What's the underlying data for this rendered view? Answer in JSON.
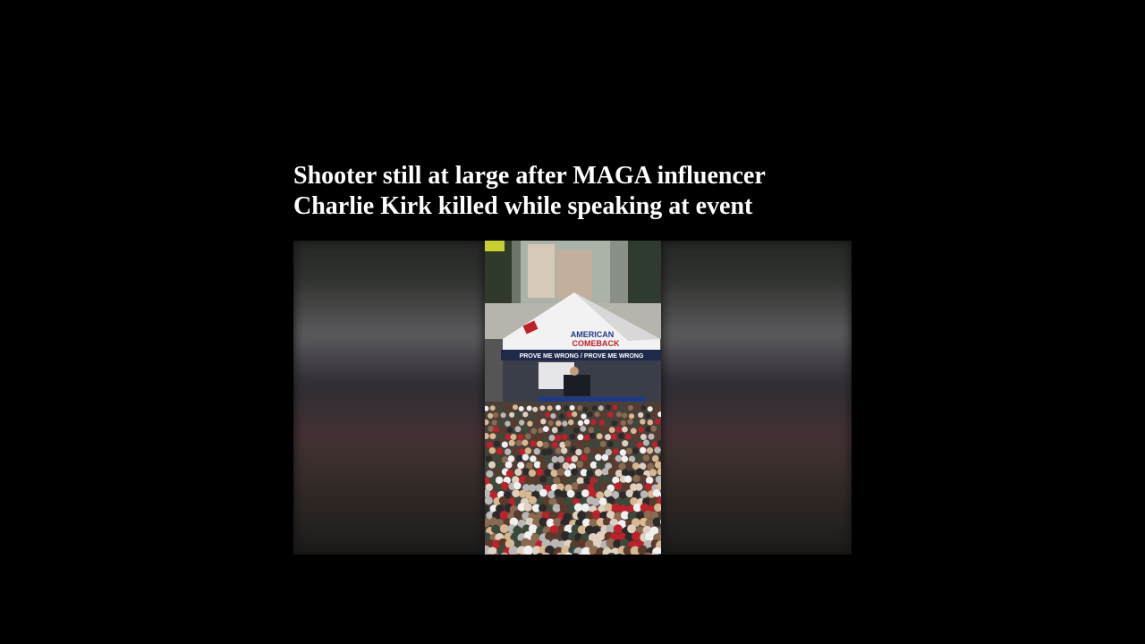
{
  "article": {
    "headline_line1": "Shooter still at large after MAGA influencer",
    "headline_line2": "Charlie Kirk killed while speaking at event"
  },
  "video": {
    "tent_brand_line1": "AMERICAN",
    "tent_brand_line2": "COMEBACK",
    "banner_text": "PROVE ME WRONG / PROVE ME WRONG"
  }
}
